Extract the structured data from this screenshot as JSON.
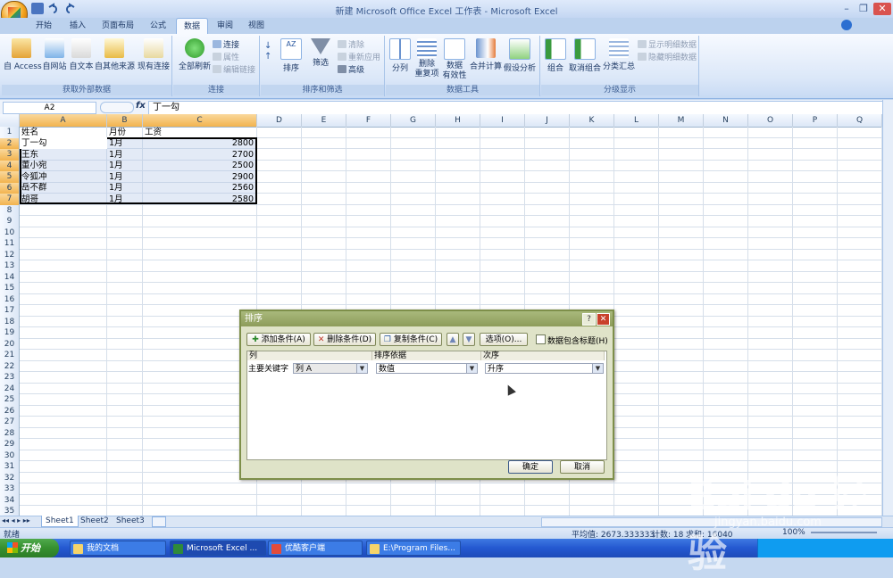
{
  "window": {
    "title": "新建 Microsoft Office Excel 工作表 - Microsoft Excel"
  },
  "tabs": [
    "开始",
    "插入",
    "页面布局",
    "公式",
    "数据",
    "审阅",
    "视图"
  ],
  "active_tab": "数据",
  "ribbon": {
    "group1": {
      "label": "获取外部数据",
      "buttons": [
        "自 Access",
        "自网站",
        "自文本",
        "自其他来源",
        "现有连接"
      ]
    },
    "group2": {
      "label": "连接",
      "big": "全部刷新",
      "small": [
        "连接",
        "属性",
        "编辑链接"
      ]
    },
    "group3": {
      "label": "排序和筛选",
      "sort": "排序",
      "filter": "筛选",
      "small": [
        "清除",
        "重新应用",
        "高级"
      ]
    },
    "group4": {
      "label": "数据工具",
      "buttons": [
        "分列",
        "删除\n重复项",
        "数据\n有效性",
        "合并计算",
        "假设分析"
      ]
    },
    "group5": {
      "label": "分级显示",
      "buttons": [
        "组合",
        "取消组合",
        "分类汇总"
      ],
      "small": [
        "显示明细数据",
        "隐藏明细数据"
      ]
    }
  },
  "formula_bar": {
    "name_box": "A2",
    "fx": "fx",
    "content": "丁一勾"
  },
  "columns": [
    "A",
    "B",
    "C",
    "D",
    "E",
    "F",
    "G",
    "H",
    "I",
    "J",
    "K",
    "L",
    "M",
    "N",
    "O",
    "P",
    "Q"
  ],
  "rows": [
    "1",
    "2",
    "3",
    "4",
    "5",
    "6",
    "7",
    "8",
    "9",
    "10",
    "11",
    "12",
    "13",
    "14",
    "15",
    "16",
    "17",
    "18",
    "19",
    "20",
    "21",
    "22",
    "23",
    "24",
    "25",
    "26",
    "27",
    "28",
    "29",
    "30",
    "31",
    "32",
    "33",
    "34",
    "35"
  ],
  "table": {
    "headers": [
      "姓名",
      "月份",
      "工资"
    ],
    "data": [
      [
        "丁一勾",
        "1月",
        "2800"
      ],
      [
        "王东",
        "1月",
        "2700"
      ],
      [
        "董小宛",
        "1月",
        "2500"
      ],
      [
        "令狐冲",
        "1月",
        "2900"
      ],
      [
        "岳不群",
        "1月",
        "2560"
      ],
      [
        "胡哥",
        "1月",
        "2580"
      ]
    ]
  },
  "sheets": [
    "Sheet1",
    "Sheet2",
    "Sheet3"
  ],
  "status": {
    "mode": "就绪",
    "average": "平均值: 2673.333333",
    "count": "计数: 18",
    "sum": "求和: 16040",
    "zoom": "100%"
  },
  "taskbar": {
    "start": "开始",
    "tasks": [
      "我的文档",
      "Microsoft Excel ...",
      "优酷客户端",
      "E:\\Program Files..."
    ]
  },
  "dialog": {
    "title": "排序",
    "add": "添加条件(A)",
    "delete": "删除条件(D)",
    "copy": "复制条件(C)",
    "options": "选项(O)...",
    "header_check": "数据包含标题(H)",
    "col_header": "列",
    "sort_on_header": "排序依据",
    "order_header": "次序",
    "row_label": "主要关键字",
    "column_value": "列 A",
    "sort_on_value": "数值",
    "order_value": "升序",
    "ok": "确定",
    "cancel": "取消"
  },
  "watermark": {
    "main": "Bai du 经验",
    "sub": "jingyan.baidu.com"
  }
}
